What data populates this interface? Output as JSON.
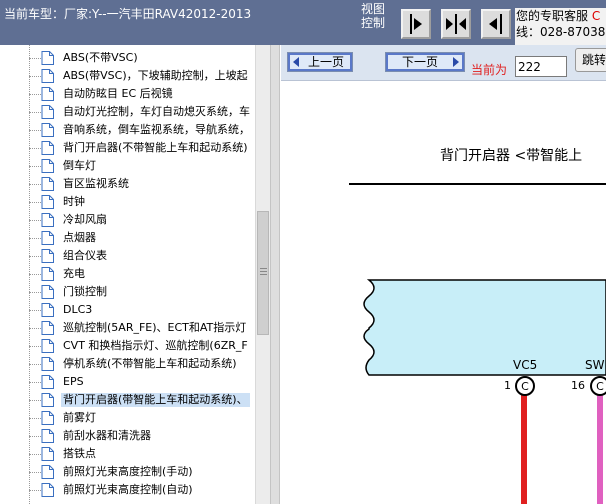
{
  "topbar": {
    "car_model": "当前车型：厂家:Y--一汽丰田RAV42012-2013",
    "view_label": "视图控制",
    "view_buttons": [
      "collapse-left-icon",
      "split-view-icon",
      "expand-left-icon"
    ],
    "support_line1_prefix": "您的专职客服",
    "support_line1_accent": "C",
    "support_line2": "线：028-87038"
  },
  "sidebar": {
    "items": [
      {
        "label": "ABS(不带VSC)"
      },
      {
        "label": "ABS(带VSC)，下坡辅助控制，上坡起"
      },
      {
        "label": "自动防眩目 EC 后视镜"
      },
      {
        "label": "自动灯光控制，车灯自动熄灭系统，车"
      },
      {
        "label": "音响系统，倒车监视系统，导航系统，"
      },
      {
        "label": "背门开启器(不带智能上车和起动系统)"
      },
      {
        "label": "倒车灯"
      },
      {
        "label": "盲区监视系统"
      },
      {
        "label": "时钟"
      },
      {
        "label": "冷却风扇"
      },
      {
        "label": "点烟器"
      },
      {
        "label": "组合仪表"
      },
      {
        "label": "充电"
      },
      {
        "label": "门锁控制"
      },
      {
        "label": "DLC3"
      },
      {
        "label": "巡航控制(5AR_FE)、ECT和AT指示灯"
      },
      {
        "label": "CVT 和换档指示灯、巡航控制(6ZR_F"
      },
      {
        "label": "停机系统(不带智能上车和起动系统)"
      },
      {
        "label": "EPS"
      },
      {
        "label": "背门开启器(带智能上车和起动系统)、"
      },
      {
        "label": "前雾灯"
      },
      {
        "label": "前刮水器和清洗器"
      },
      {
        "label": "搭铁点"
      },
      {
        "label": "前照灯光束高度控制(手动)"
      },
      {
        "label": "前照灯光束高度控制(自动)"
      }
    ],
    "selected_index": 19
  },
  "nav": {
    "prev_label": "上一页",
    "next_label": "下一页",
    "current_label": "当前为",
    "current_page": "222",
    "jump_label": "跳转"
  },
  "diagram": {
    "title": "背门开启器 <带智能上",
    "connectors": [
      {
        "name": "VC5",
        "pin": "1",
        "symbol": "C",
        "wire_color": "#e02020"
      },
      {
        "name": "SW",
        "pin": "16",
        "symbol": "C",
        "wire_color": "#e060c0"
      }
    ],
    "component_fill": "#c8eef8"
  }
}
